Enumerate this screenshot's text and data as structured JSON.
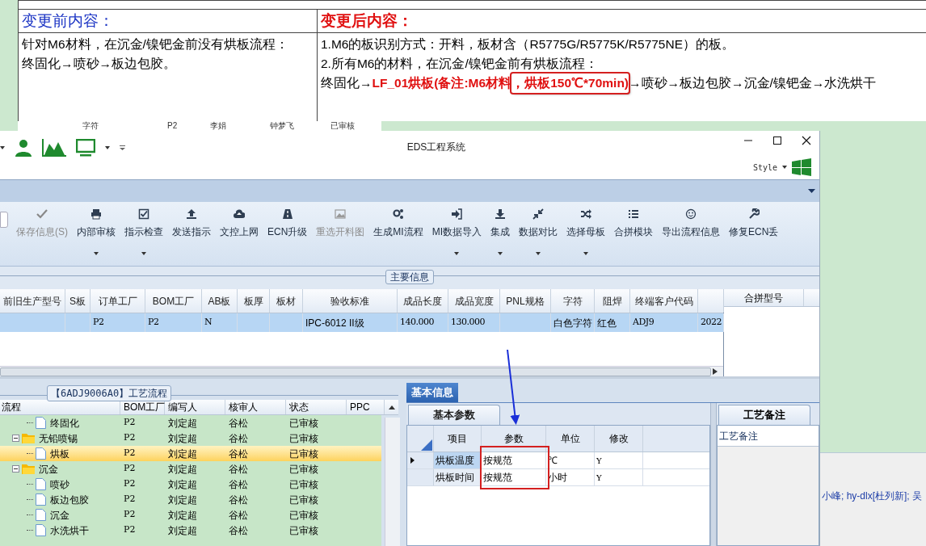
{
  "document": {
    "headers": [
      {
        "text": "变更前内容：",
        "kind": "before"
      },
      {
        "text": "变更后内容：",
        "kind": "after"
      }
    ],
    "before_lines": [
      "针对M6材料，在沉金/镍钯金前没有烘板流程：",
      "终固化→喷砂→板边包胶。"
    ],
    "after_lines": [
      [
        {
          "text": "1.M6的板识别方式：开料，板材含（R5775G/R5775K/R5775NE）的板。",
          "kind": "plain"
        }
      ],
      [
        {
          "text": "2.所有M6的材料，在沉金/镍钯金前有烘板流程：",
          "kind": "plain"
        }
      ],
      [
        {
          "text": "终固化→",
          "kind": "plain"
        },
        {
          "text": "LF_01烘板(备注:M6材料",
          "kind": "emphasis"
        },
        {
          "text": "，烘板150℃*70min)",
          "kind": "emphasis_boxed"
        },
        {
          "text": "→喷砂→板边包胶→沉金/镍钯金→水洗烘干",
          "kind": "plain"
        }
      ]
    ]
  },
  "background_row": [
    "字符",
    "P2",
    "李娟",
    "钟梦飞",
    "已审核"
  ],
  "window": {
    "title": "EDS工程系统",
    "style_label": "Style"
  },
  "ribbon": {
    "buttons": [
      {
        "label": "保存信息(S)",
        "disabled": true,
        "dropdown": false
      },
      {
        "label": "内部审核",
        "disabled": false,
        "dropdown": true
      },
      {
        "label": "指示检查",
        "disabled": false,
        "dropdown": true
      },
      {
        "label": "发送指示",
        "disabled": false,
        "dropdown": false
      },
      {
        "label": "文控上网",
        "disabled": false,
        "dropdown": false
      },
      {
        "label": "ECN升级",
        "disabled": false,
        "dropdown": false
      },
      {
        "label": "重选开料图",
        "disabled": true,
        "dropdown": false
      },
      {
        "label": "生成MI流程",
        "disabled": false,
        "dropdown": false
      },
      {
        "label": "MI数据导入",
        "disabled": false,
        "dropdown": true
      },
      {
        "label": "集成",
        "disabled": false,
        "dropdown": true
      },
      {
        "label": "数据对比",
        "disabled": false,
        "dropdown": true
      },
      {
        "label": "选择母板",
        "disabled": false,
        "dropdown": true
      },
      {
        "label": "合拼模块",
        "disabled": false,
        "dropdown": false
      },
      {
        "label": "导出流程信息",
        "disabled": false,
        "dropdown": false
      },
      {
        "label": "修复ECN丢",
        "disabled": false,
        "dropdown": false
      }
    ]
  },
  "main_info": {
    "title": "主要信息",
    "row_selected": true,
    "side_column": "合拼型号",
    "columns": [
      {
        "label": "前旧生产型号"
      },
      {
        "label": "S板"
      },
      {
        "label": "订单工厂",
        "cell": "P2"
      },
      {
        "label": "BOM工厂",
        "cell": "P2"
      },
      {
        "label": "AB板",
        "cell": "N"
      },
      {
        "label": "板厚"
      },
      {
        "label": "板材"
      },
      {
        "label": "验收标准",
        "cell": "IPC-6012 II级"
      },
      {
        "label": "成品长度",
        "cell": "140.000"
      },
      {
        "label": "成品宽度",
        "cell": "130.000"
      },
      {
        "label": "PNL规格"
      },
      {
        "label": "字符",
        "cell": "白色字符"
      },
      {
        "label": "阻焊",
        "cell": "红色"
      },
      {
        "label": "终端客户代码",
        "cell": "ADJ9"
      },
      {
        "cell": "2022"
      }
    ]
  },
  "process": {
    "tab": "【6ADJ9006A0】工艺流程",
    "columns": [
      "流程",
      "BOM工厂",
      "编写人",
      "核审人",
      "状态",
      "PPC"
    ],
    "tree": [
      {
        "children": [
          {
            "label": "终固化",
            "kind": "file",
            "bom": "P2",
            "writer": "刘定超",
            "reviewer": "谷松",
            "status": "已审核",
            "selected": false
          }
        ]
      },
      {
        "label": "无铅喷锡",
        "kind": "folder",
        "expanded": true,
        "bom": "P2",
        "writer": "刘定超",
        "reviewer": "谷松",
        "status": "已审核",
        "selected": false,
        "children": [
          {
            "label": "烘板",
            "kind": "file",
            "bom": "P2",
            "writer": "刘定超",
            "reviewer": "谷松",
            "status": "已审核",
            "selected": true
          }
        ]
      },
      {
        "label": "沉金",
        "kind": "folder",
        "expanded": true,
        "bom": "P2",
        "writer": "刘定超",
        "reviewer": "谷松",
        "status": "已审核",
        "selected": false,
        "children": [
          {
            "label": "喷砂",
            "kind": "file",
            "bom": "P2",
            "writer": "刘定超",
            "reviewer": "谷松",
            "status": "已审核",
            "selected": false
          },
          {
            "label": "板边包胶",
            "kind": "file",
            "bom": "P2",
            "writer": "刘定超",
            "reviewer": "谷松",
            "status": "已审核",
            "selected": false
          },
          {
            "label": "沉金",
            "kind": "file",
            "bom": "P2",
            "writer": "刘定超",
            "reviewer": "谷松",
            "status": "已审核",
            "selected": false
          },
          {
            "label": "水洗烘干",
            "kind": "file",
            "bom": "P2",
            "writer": "刘定超",
            "reviewer": "谷松",
            "status": "已审核",
            "selected": false
          }
        ]
      }
    ]
  },
  "basic_info": {
    "tab": "基本信息",
    "subtab": "基本参数",
    "columns": [
      {
        "label": "项目",
        "highlighted": false
      },
      {
        "label": "参数",
        "highlighted": true
      },
      {
        "label": "单位",
        "highlighted": false
      },
      {
        "label": "修改",
        "highlighted": false
      }
    ],
    "rows": [
      {
        "cells": [
          "烘板温度",
          "按规范",
          "℃",
          "Y"
        ],
        "selected": true
      },
      {
        "cells": [
          "烘板时间",
          "按规范",
          "小时",
          "Y"
        ],
        "selected": false
      }
    ]
  },
  "remarks": {
    "tab": "工艺备注",
    "header": "工艺备注"
  },
  "background_text": "小峰; hy-dlx[杜列新]; 吴"
}
